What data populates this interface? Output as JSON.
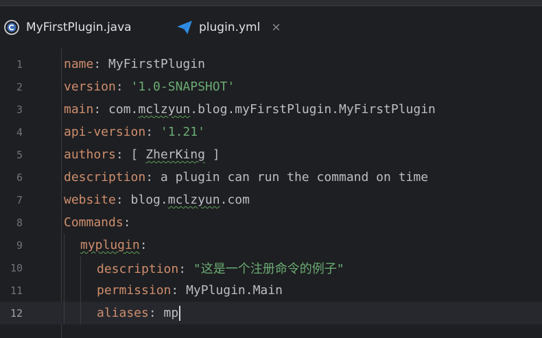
{
  "tabs": [
    {
      "label": "MyFirstPlugin.java",
      "icon": "java-class-icon",
      "active": false
    },
    {
      "label": "plugin.yml",
      "icon": "yaml-plugin-icon",
      "active": true,
      "close": "×"
    }
  ],
  "editor": {
    "lines": [
      {
        "n": "1",
        "key": "name",
        "sep": ": ",
        "value": "MyFirstPlugin",
        "type": "plain"
      },
      {
        "n": "2",
        "key": "version",
        "sep": ": ",
        "value": "'1.0-SNAPSHOT'",
        "type": "string"
      },
      {
        "n": "3",
        "key": "main",
        "sep": ": ",
        "value": "com.mclzyun.blog.myFirstPlugin.MyFirstPlugin",
        "type": "plain"
      },
      {
        "n": "4",
        "key": "api-version",
        "sep": ": ",
        "value": "'1.21'",
        "type": "string"
      },
      {
        "n": "5",
        "key": "authors",
        "sep": ": ",
        "value": "[ ZherKing ]",
        "type": "plain"
      },
      {
        "n": "6",
        "key": "description",
        "sep": ": ",
        "value": "a plugin can run the command on time",
        "type": "plain"
      },
      {
        "n": "7",
        "key": "website",
        "sep": ": ",
        "value": "blog.mclzyun.com",
        "type": "plain"
      },
      {
        "n": "8",
        "key": "Commands",
        "sep": ":",
        "value": "",
        "type": "plain"
      },
      {
        "n": "9",
        "key": "myplugin",
        "sep": ":",
        "value": "",
        "type": "plain"
      },
      {
        "n": "10",
        "key": "description",
        "sep": ": ",
        "value": "\"这是一个注册命令的例子\"",
        "type": "string"
      },
      {
        "n": "11",
        "key": "permission",
        "sep": ": ",
        "value": "MyPlugin.Main",
        "type": "plain"
      },
      {
        "n": "12",
        "key": "aliases",
        "sep": ": ",
        "value": "mp",
        "type": "plain"
      }
    ],
    "current_line": "12"
  },
  "colors": {
    "background": "#1e1f22",
    "key": "#cf8e6d",
    "string": "#6aab73",
    "text": "#bcbec4",
    "accent": "#3574f0"
  }
}
